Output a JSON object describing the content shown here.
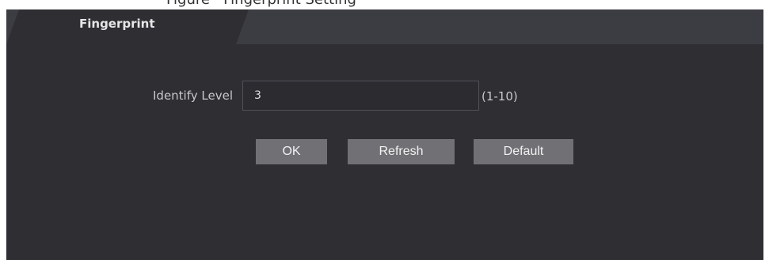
{
  "tab": {
    "title": "Fingerprint"
  },
  "form": {
    "identify_level": {
      "label": "Identify Level",
      "value": "3",
      "range": "(1-10)"
    }
  },
  "buttons": {
    "ok_label": "OK",
    "refresh_label": "Refresh",
    "default_label": "Default"
  },
  "colors": {
    "panel_bg": "#2e2e33",
    "tab_bar_bg": "#3c3c43",
    "button_bg": "#707075",
    "text": "#c9c9cc"
  }
}
